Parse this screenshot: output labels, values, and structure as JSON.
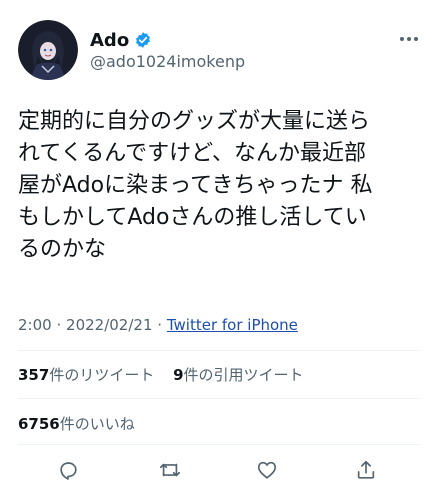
{
  "tweet": {
    "author": {
      "display_name": "Ado",
      "handle": "@ado1024imokenp",
      "verified": true
    },
    "text_lines": [
      "定期的に自分のグッズが大量に送ら",
      "れてくるんですけど、なんか最近部",
      "屋がAdoに染まってきちゃったナ 私",
      "もしかしてAdoさんの推し活してい",
      "るのかな"
    ],
    "time": "2:00",
    "separator": "·",
    "date": "2022/02/21",
    "source": "Twitter for iPhone"
  },
  "stats": {
    "retweets_count": "357",
    "retweets_label": "件のリツイート",
    "quotes_count": "9",
    "quotes_label": "件の引用ツイート",
    "likes_count": "6756",
    "likes_label": "件のいいね"
  },
  "icons": {
    "more": "more-horizontal-icon",
    "verified": "verified-badge-icon",
    "reply": "reply-icon",
    "retweet": "retweet-icon",
    "like": "like-icon",
    "share": "share-icon"
  },
  "colors": {
    "text": "#0f1419",
    "secondary": "#536471",
    "verified": "#1d9bf0",
    "source_link": "#1d4eb0",
    "divider": "#eff3f4"
  }
}
